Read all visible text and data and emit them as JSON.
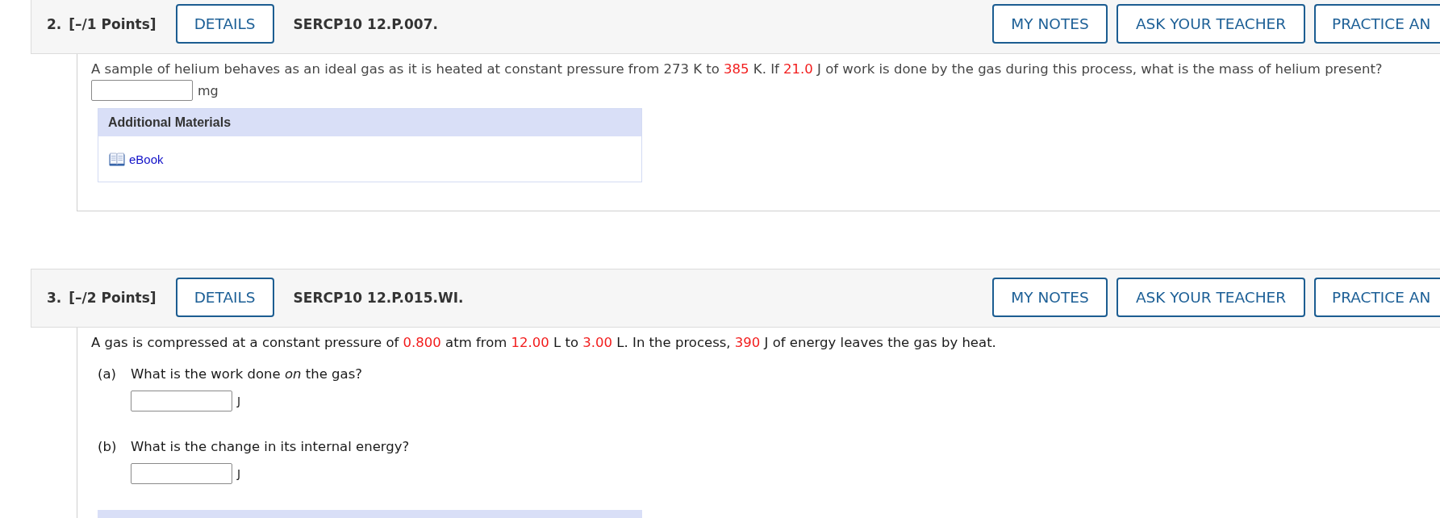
{
  "questions": [
    {
      "number": "2.",
      "points": "[–/1 Points]",
      "details_button": "DETAILS",
      "code": "SERCP10 12.P.007.",
      "header_buttons": [
        {
          "kind": "notes",
          "label": "MY NOTES"
        },
        {
          "kind": "teacher",
          "label": "ASK YOUR TEACHER"
        },
        {
          "kind": "practice",
          "label": "PRACTICE AN"
        }
      ],
      "prompt": [
        {
          "text": "A sample of helium behaves as an ideal gas as it is heated at constant pressure from 273 K to ",
          "highlight": false
        },
        {
          "text": "385",
          "highlight": true
        },
        {
          "text": " K. If ",
          "highlight": false
        },
        {
          "text": "21.0",
          "highlight": true
        },
        {
          "text": " J of work is done by the gas during this process, what is the mass of helium present?",
          "highlight": false
        }
      ],
      "answer": {
        "unit": "mg"
      },
      "materials_panel": {
        "shown": true,
        "title": "Additional Materials",
        "links": [
          {
            "label": "eBook"
          }
        ]
      }
    },
    {
      "number": "3.",
      "points": "[–/2 Points]",
      "details_button": "DETAILS",
      "code": "SERCP10 12.P.015.WI.",
      "header_buttons": [
        {
          "kind": "notes",
          "label": "MY NOTES"
        },
        {
          "kind": "teacher",
          "label": "ASK YOUR TEACHER"
        },
        {
          "kind": "practice",
          "label": "PRACTICE AN"
        }
      ],
      "prompt": [
        {
          "text": "A gas is compressed at a constant pressure of ",
          "highlight": false
        },
        {
          "text": "0.800",
          "highlight": true
        },
        {
          "text": " atm from ",
          "highlight": false
        },
        {
          "text": "12.00",
          "highlight": true
        },
        {
          "text": " L to ",
          "highlight": false
        },
        {
          "text": "3.00",
          "highlight": true
        },
        {
          "text": " L. In the process, ",
          "highlight": false
        },
        {
          "text": "390",
          "highlight": true
        },
        {
          "text": " J of energy leaves the gas by heat.",
          "highlight": false
        }
      ],
      "parts": [
        {
          "label": "(a)",
          "question": "What is the work done *on* the gas?",
          "unit": "J"
        },
        {
          "label": "(b)",
          "question": "What is the change in its internal energy?",
          "unit": "J"
        }
      ],
      "materials_panel": {
        "shown": true
      }
    }
  ]
}
